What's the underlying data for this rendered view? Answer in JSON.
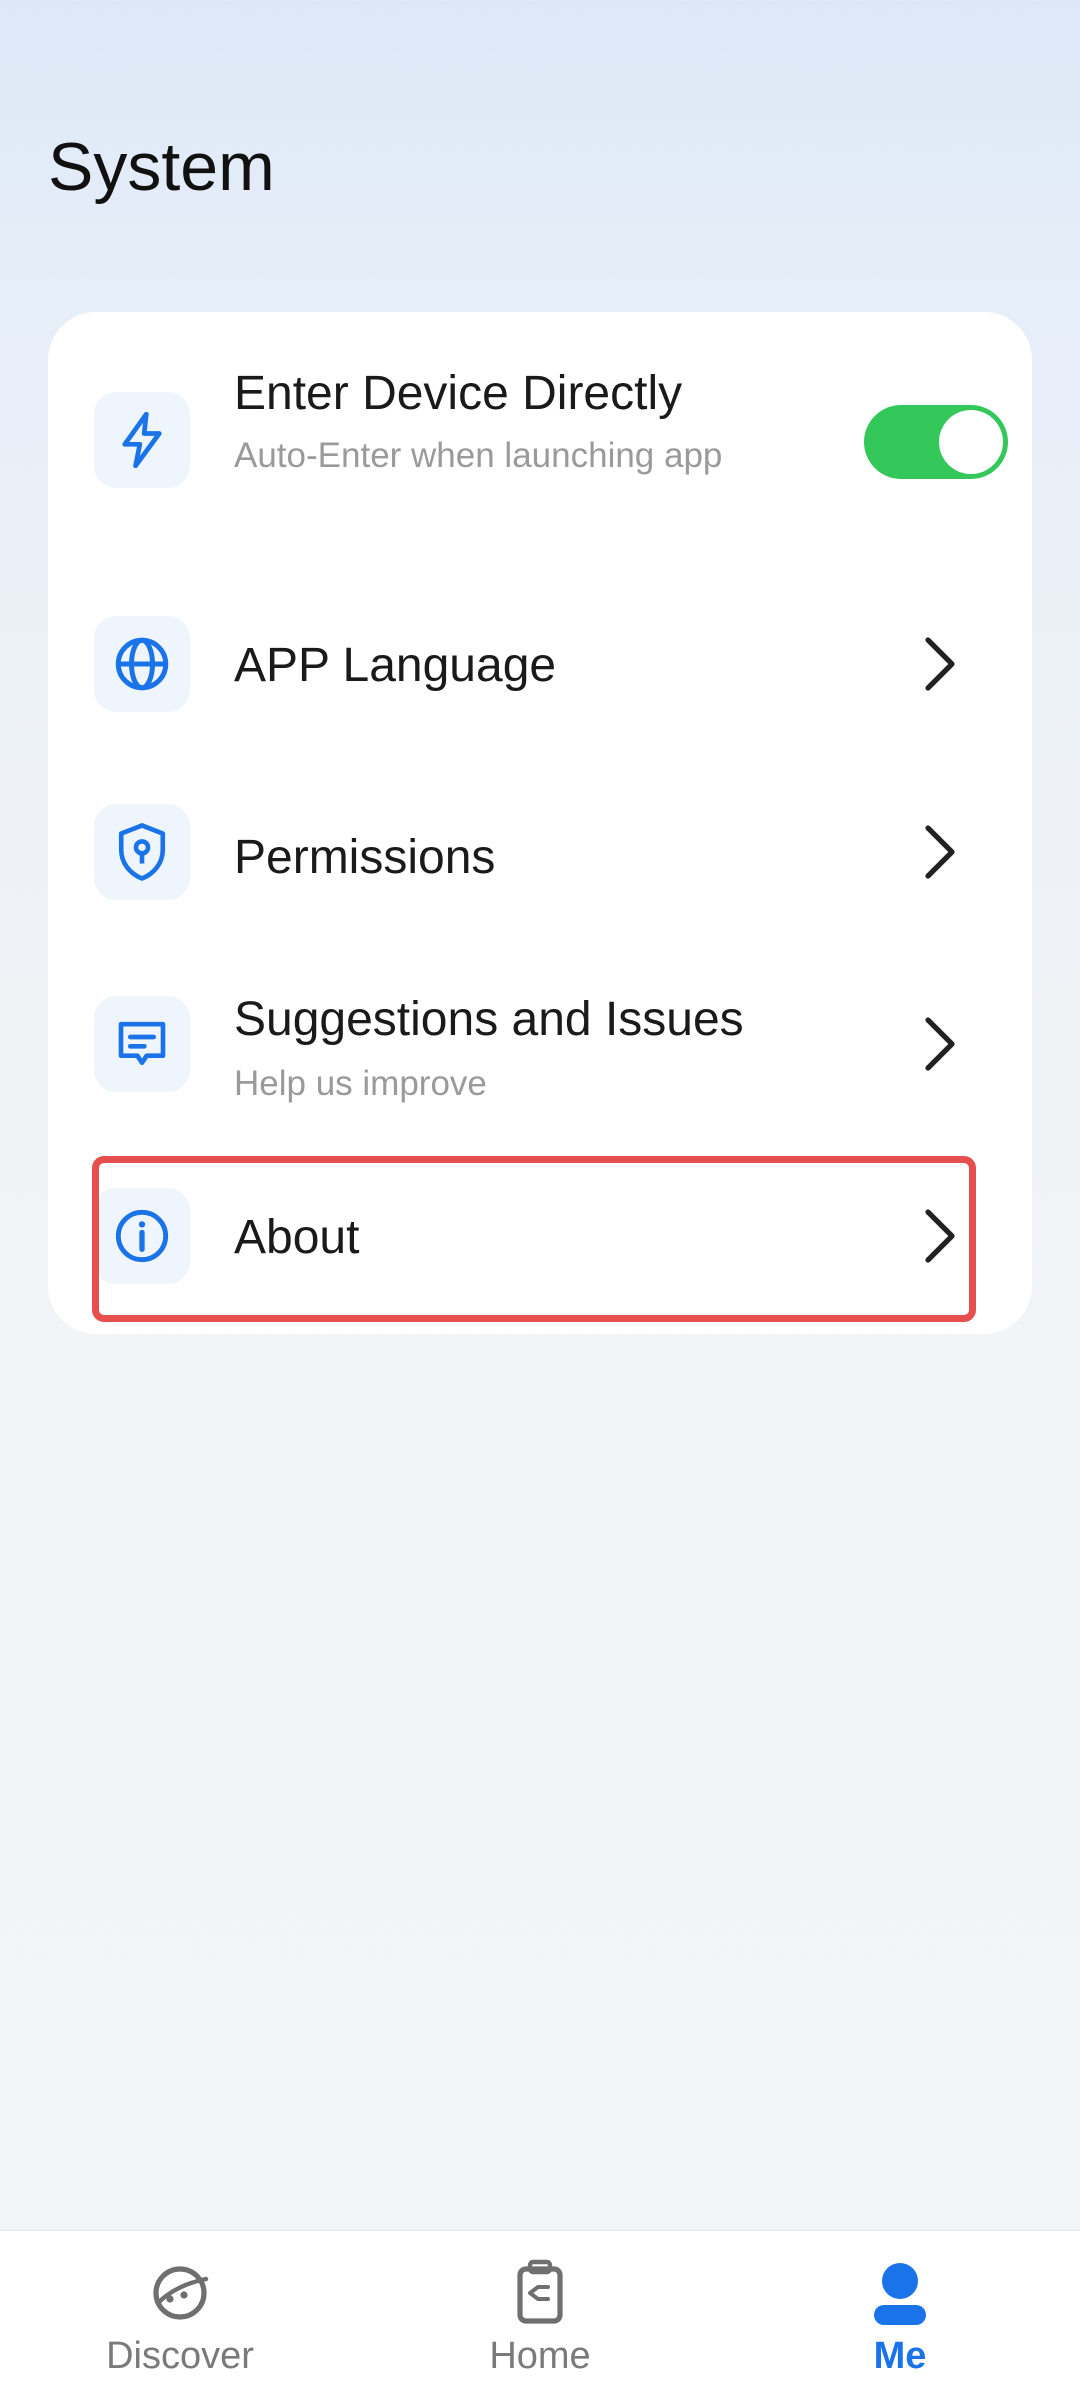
{
  "page": {
    "title": "System"
  },
  "settings": {
    "enter_device": {
      "title": "Enter Device Directly",
      "subtitle": "Auto-Enter when launching app",
      "toggle_on": true
    },
    "language": {
      "title": "APP Language"
    },
    "permissions": {
      "title": "Permissions"
    },
    "suggestions": {
      "title": "Suggestions and Issues",
      "subtitle": "Help us improve"
    },
    "about": {
      "title": "About"
    }
  },
  "tabbar": {
    "items": [
      {
        "label": "Discover",
        "icon": "planet-icon",
        "active": false
      },
      {
        "label": "Home",
        "icon": "device-icon",
        "active": false
      },
      {
        "label": "Me",
        "icon": "person-icon",
        "active": true
      }
    ]
  },
  "colors": {
    "accent": "#1a73e8",
    "toggle": "#34c759",
    "highlight": "#e5504f"
  }
}
